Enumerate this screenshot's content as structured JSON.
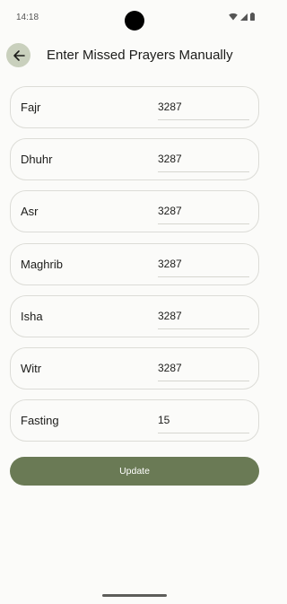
{
  "status_bar": {
    "time": "14:18"
  },
  "header": {
    "title": "Enter Missed Prayers Manually",
    "back_icon": "arrow-left-icon"
  },
  "rows": [
    {
      "label": "Fajr",
      "value": "3287"
    },
    {
      "label": "Dhuhr",
      "value": "3287"
    },
    {
      "label": "Asr",
      "value": "3287"
    },
    {
      "label": "Maghrib",
      "value": "3287"
    },
    {
      "label": "Isha",
      "value": "3287"
    },
    {
      "label": "Witr",
      "value": "3287"
    },
    {
      "label": "Fasting",
      "value": "15"
    }
  ],
  "update_button": {
    "label": "Update"
  },
  "colors": {
    "accent": "#6a7a55",
    "back_button_bg": "#c9d0bd",
    "background": "#fbfbf9"
  }
}
